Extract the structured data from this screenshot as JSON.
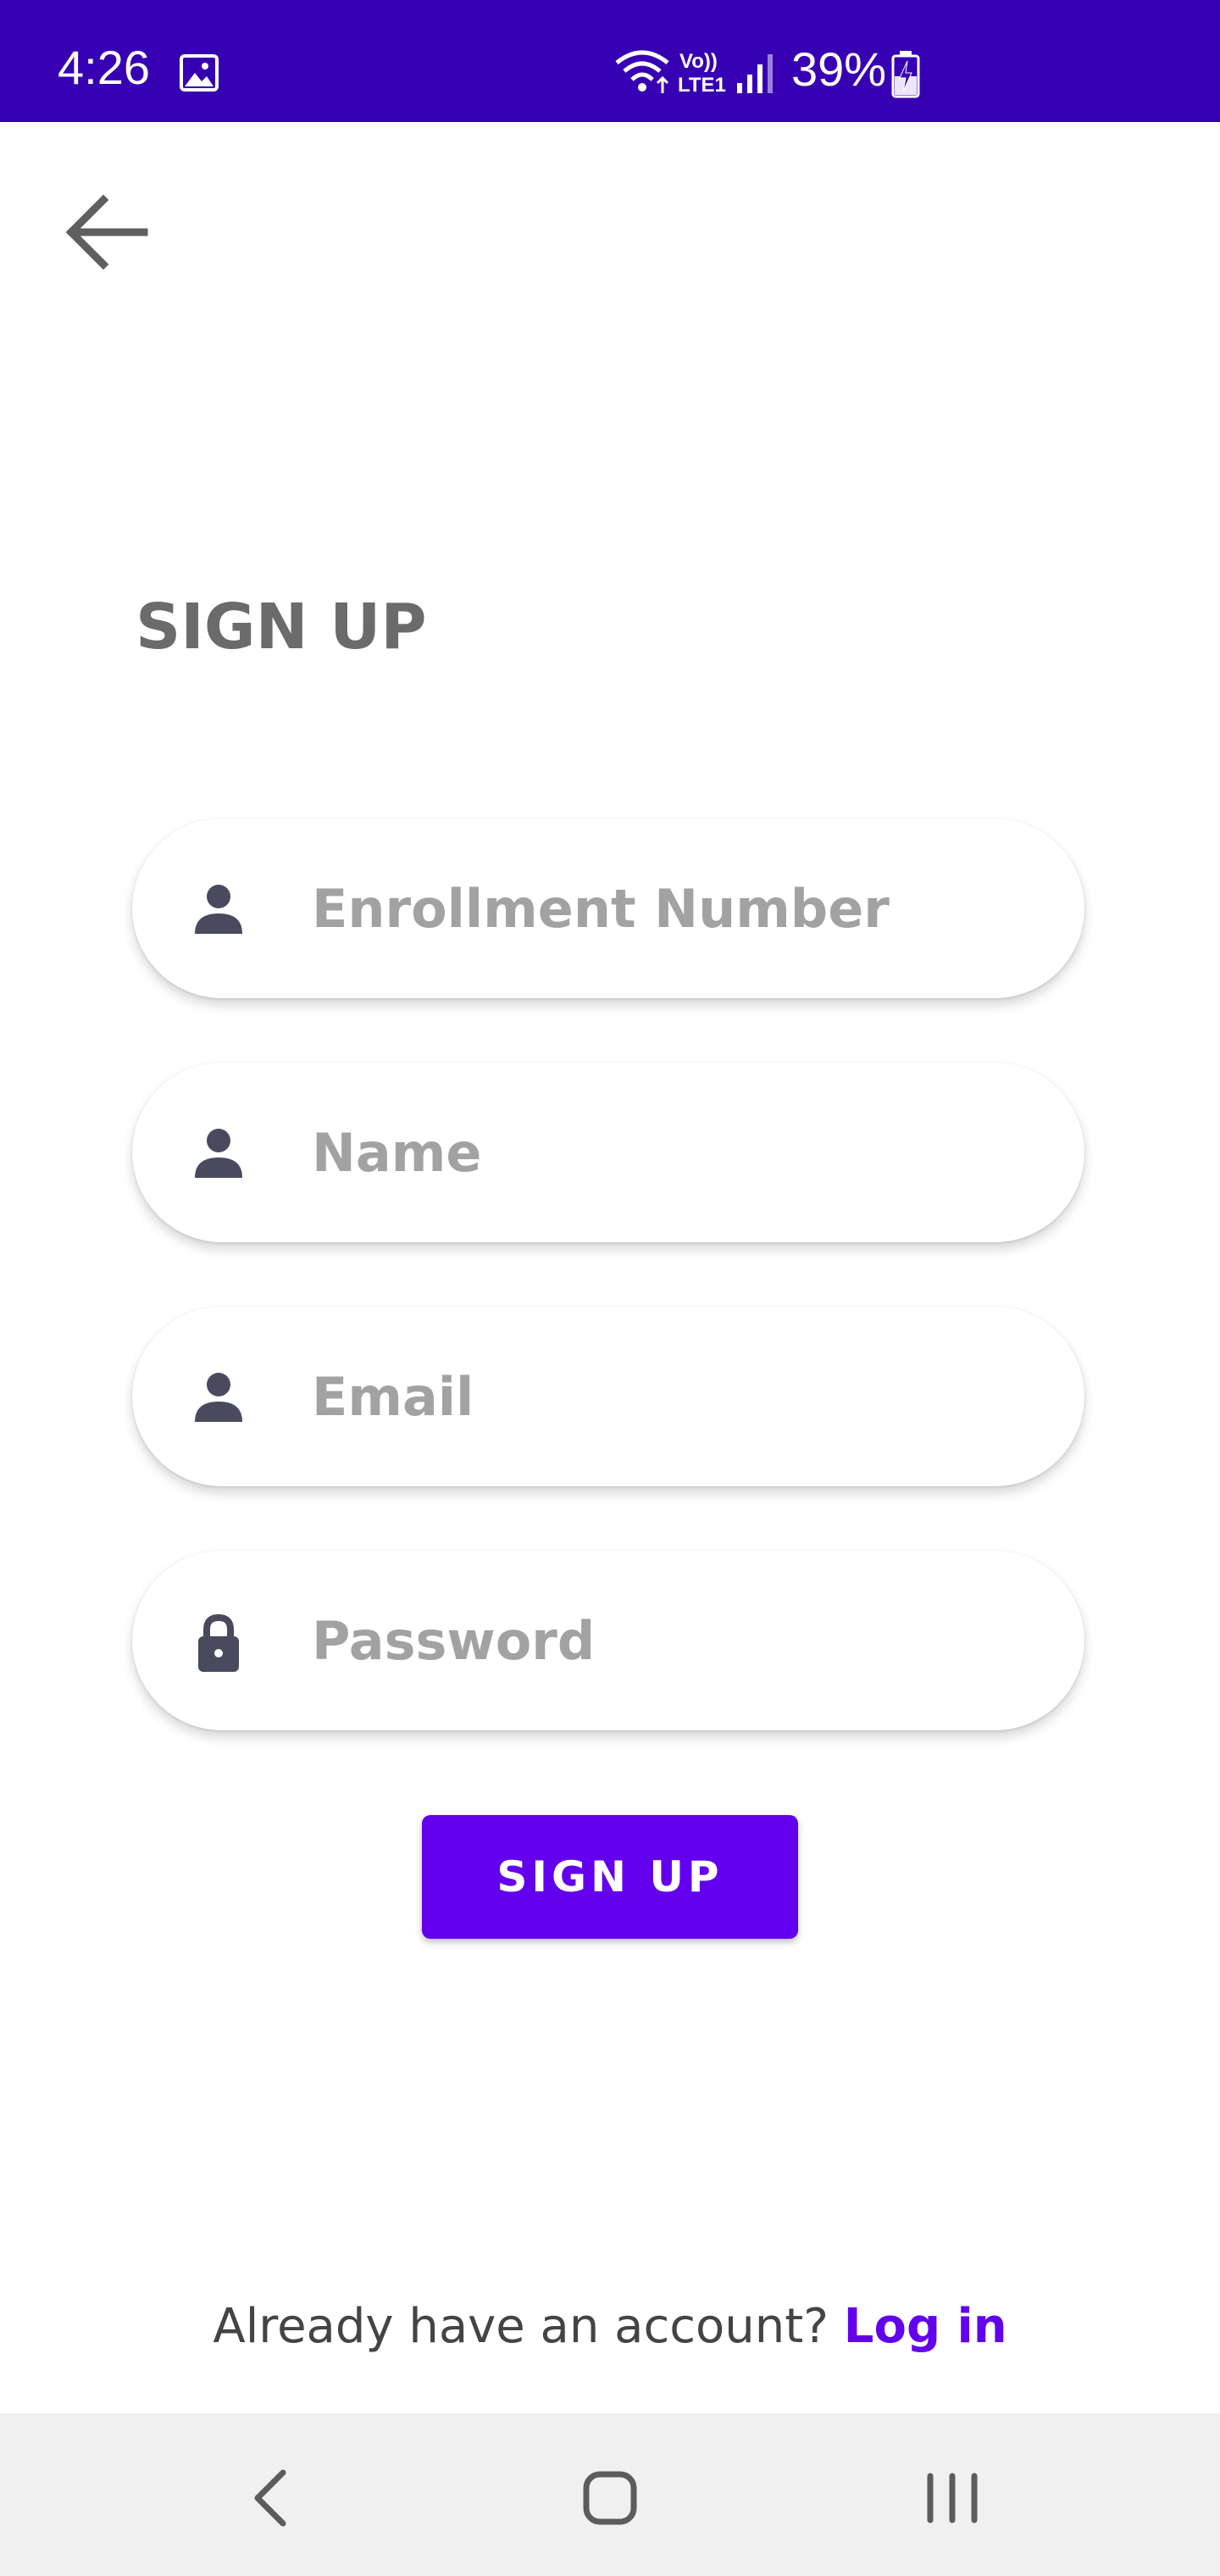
{
  "status_bar": {
    "time": "4:26",
    "battery_percent": "39%",
    "icons": [
      "gallery-icon",
      "wifi-icon",
      "volte-icon",
      "signal-icon",
      "battery-charging-icon"
    ],
    "background": "#3700b3"
  },
  "header": {
    "back_icon": "arrow-left-icon"
  },
  "form": {
    "title": "SIGN UP",
    "fields": [
      {
        "placeholder": "Enrollment Number",
        "icon": "person-icon"
      },
      {
        "placeholder": "Name",
        "icon": "person-icon"
      },
      {
        "placeholder": "Email",
        "icon": "person-icon"
      },
      {
        "placeholder": "Password",
        "icon": "lock-icon"
      }
    ],
    "submit_label": "SIGN UP"
  },
  "footer": {
    "prompt_text": "Already have an account?",
    "login_label": "Log in"
  },
  "nav_bar": {
    "icons": [
      "nav-back-icon",
      "nav-home-icon",
      "nav-recents-icon"
    ]
  },
  "colors": {
    "accent": "#6200ee",
    "status_bar": "#3700b3",
    "title": "#6b6b6b",
    "placeholder": "#a2a2a2",
    "icon": "#4a4a5e"
  }
}
